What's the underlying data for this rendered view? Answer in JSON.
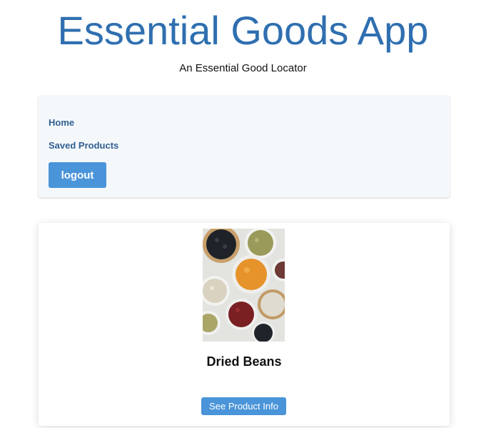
{
  "header": {
    "title": "Essential Goods App",
    "subtitle": "An Essential Good Locator"
  },
  "nav": {
    "home_label": "Home",
    "saved_label": "Saved Products",
    "logout_label": "logout"
  },
  "product": {
    "name": "Dried Beans",
    "info_button_label": "See Product Info",
    "image_alt": "bowls of dried beans"
  },
  "colors": {
    "accent": "#4a94d9",
    "title": "#2f6fb0",
    "nav_link": "#2f5f93",
    "nav_background": "#f5f8fb"
  }
}
